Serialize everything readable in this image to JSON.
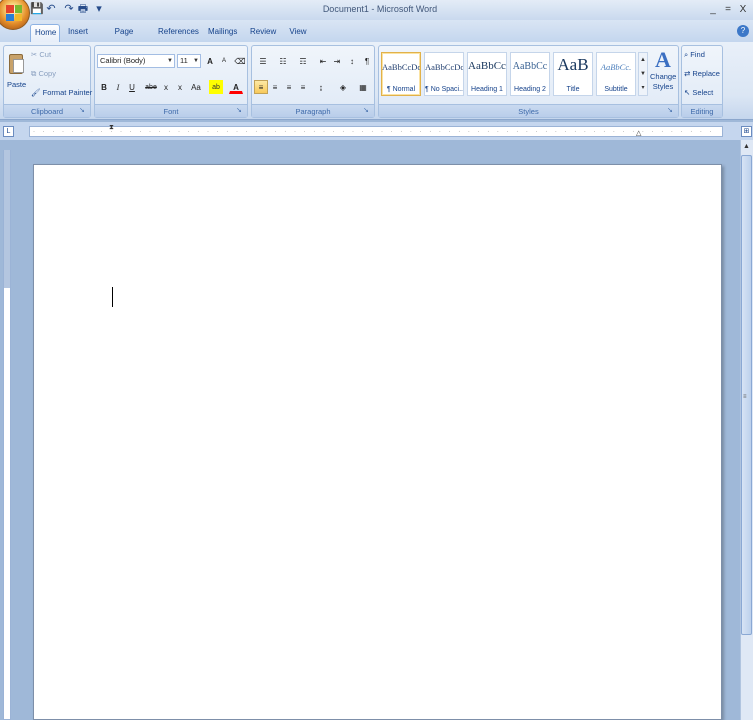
{
  "window": {
    "title": "Document1 - Microsoft Word",
    "minimize": "_",
    "restore": "=",
    "close": "X"
  },
  "quick_access": {
    "save": "💾",
    "undo": "↶",
    "redo": "↷",
    "print": "🖶",
    "more": "▾"
  },
  "tabs": [
    "Home",
    "Insert",
    "Page Layout",
    "References",
    "Mailings",
    "Review",
    "View"
  ],
  "help_icon": "?",
  "clipboard": {
    "label": "Clipboard",
    "paste": "Paste",
    "cut": "Cut",
    "copy": "Copy",
    "format_painter": "Format Painter"
  },
  "font": {
    "label": "Font",
    "family": "Calibri (Body)",
    "size": "11",
    "grow": "A",
    "shrink": "A",
    "clear": "⌫",
    "bold": "B",
    "italic": "I",
    "underline": "U",
    "strike": "abe",
    "subscript": "x",
    "superscript": "x",
    "change_case": "Aa",
    "highlight": "ab",
    "color": "A"
  },
  "paragraph": {
    "label": "Paragraph",
    "bullets": "☰",
    "numbering": "☷",
    "multilevel": "☶",
    "decrease_indent": "⇤",
    "increase_indent": "⇥",
    "sort": "↕",
    "show_marks": "¶",
    "align_left": "≡",
    "center": "≡",
    "align_right": "≡",
    "justify": "≡",
    "line_spacing": "↨",
    "shading": "◈",
    "borders": "▦"
  },
  "styles": {
    "label": "Styles",
    "items": [
      {
        "sample": "AaBbCcDc",
        "name": "¶ Normal"
      },
      {
        "sample": "AaBbCcDc",
        "name": "¶ No Spaci..."
      },
      {
        "sample": "AaBbCc",
        "name": "Heading 1"
      },
      {
        "sample": "AaBbCc",
        "name": "Heading 2"
      },
      {
        "sample": "AaB",
        "name": "Title"
      },
      {
        "sample": "AaBbCc.",
        "name": "Subtitle"
      }
    ],
    "change_styles_line1": "Change",
    "change_styles_line2": "Styles",
    "change_styles_glyph": "A"
  },
  "editing": {
    "label": "Editing",
    "find": "Find",
    "replace": "Replace",
    "select": "Select"
  },
  "colors": {
    "accent": "#15428b",
    "highlight_yellow": "#ffff00",
    "font_red": "#ff0000"
  }
}
